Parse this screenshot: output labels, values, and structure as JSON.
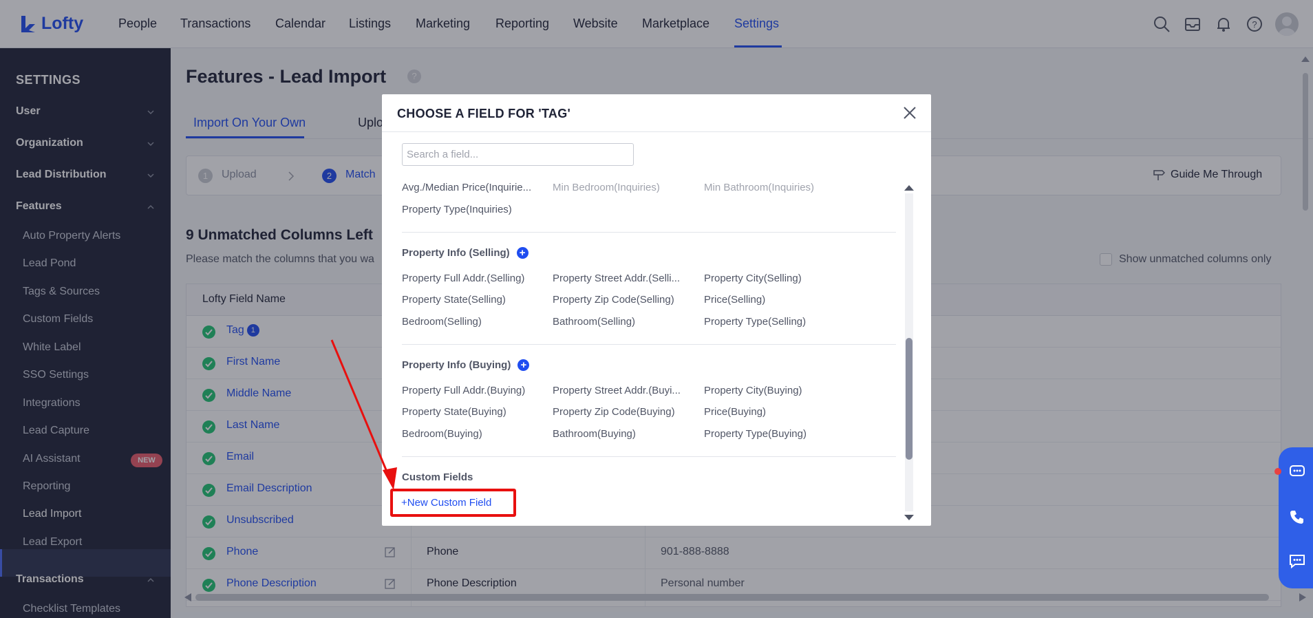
{
  "app": {
    "logo_text": "Lofty"
  },
  "nav": {
    "items": [
      "People",
      "Transactions",
      "Calendar",
      "Listings",
      "Marketing",
      "Reporting",
      "Website",
      "Marketplace",
      "Settings"
    ],
    "active": "Settings"
  },
  "sidebar": {
    "title": "SETTINGS",
    "sections": [
      "User",
      "Organization",
      "Lead Distribution",
      "Features"
    ],
    "feature_items": [
      "Auto Property Alerts",
      "Lead Pond",
      "Tags & Sources",
      "Custom Fields",
      "White Label",
      "SSO Settings",
      "Integrations",
      "Lead Capture",
      "AI Assistant",
      "Reporting",
      "Lead Import",
      "Lead Export"
    ],
    "new_badge": "NEW",
    "active_item": "Lead Import",
    "transactions_section": "Transactions",
    "transactions_items": [
      "Checklist Templates"
    ]
  },
  "page": {
    "title": "Features - Lead Import",
    "help_icon": "?",
    "tabs": [
      "Import On Your Own",
      "Uplo"
    ],
    "steps": [
      {
        "num": "1",
        "label": "Upload"
      },
      {
        "num": "2",
        "label": "Match"
      }
    ],
    "guide_label": "Guide Me Through",
    "unmatched_title": "9 Unmatched Columns Left",
    "unmatched_sub": "Please match the columns that you wa",
    "show_unmatched_label": "Show unmatched columns only",
    "table_header": "Lofty Field Name",
    "rows": [
      {
        "name": "Tag",
        "badge": "1",
        "col2": "",
        "col3": ""
      },
      {
        "name": "First Name",
        "col2": "",
        "col3": ""
      },
      {
        "name": "Middle Name",
        "col2": "",
        "col3": ""
      },
      {
        "name": "Last Name",
        "col2": "",
        "col3": ""
      },
      {
        "name": "Email",
        "col2": "",
        "col3": ""
      },
      {
        "name": "Email Description",
        "col2": "",
        "col3": ""
      },
      {
        "name": "Unsubscribed",
        "col2": "",
        "col3": ""
      },
      {
        "name": "Phone",
        "col2": "Phone",
        "col3": "901-888-8888"
      },
      {
        "name": "Phone Description",
        "col2": "Phone Description",
        "col3": "Personal number"
      }
    ]
  },
  "dialog": {
    "title": "CHOOSE A FIELD FOR 'TAG'",
    "search_placeholder": "Search a field...",
    "inquiries_fields": [
      "Avg./Median Price(Inquirie...",
      "Min Bedroom(Inquiries)",
      "Min Bathroom(Inquiries)",
      "Property Type(Inquiries)"
    ],
    "selling_group": "Property Info (Selling)",
    "selling_fields": [
      "Property Full Addr.(Selling)",
      "Property Street Addr.(Selli...",
      "Property City(Selling)",
      "Property State(Selling)",
      "Property Zip Code(Selling)",
      "Price(Selling)",
      "Bedroom(Selling)",
      "Bathroom(Selling)",
      "Property Type(Selling)"
    ],
    "buying_group": "Property Info (Buying)",
    "buying_fields": [
      "Property Full Addr.(Buying)",
      "Property Street Addr.(Buyi...",
      "Property City(Buying)",
      "Property State(Buying)",
      "Property Zip Code(Buying)",
      "Price(Buying)",
      "Bedroom(Buying)",
      "Bathroom(Buying)",
      "Property Type(Buying)"
    ],
    "custom_group": "Custom Fields",
    "new_custom_field": "+New Custom Field"
  },
  "colors": {
    "accent": "#1f4df0",
    "sidebar_bg": "#202437",
    "highlight": "#e8100f",
    "success": "#20c472"
  },
  "icons": [
    "search-icon",
    "inbox-icon",
    "bell-icon",
    "help-icon",
    "close-icon",
    "plus-icon",
    "check-icon",
    "edit-icon",
    "chat-icon",
    "phone-icon",
    "message-icon",
    "signpost-icon"
  ]
}
